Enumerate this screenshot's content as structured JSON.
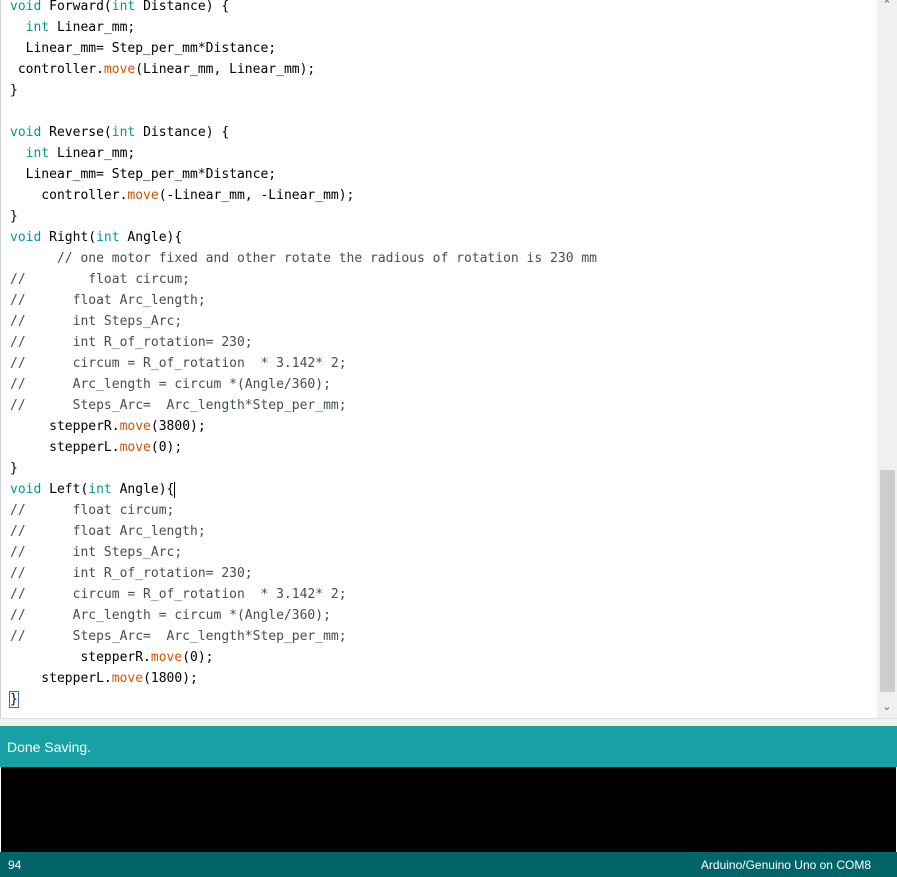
{
  "editor": {
    "lines": [
      [
        {
          "t": "void",
          "c": "kw"
        },
        {
          "t": " Forward(",
          "c": "p"
        },
        {
          "t": "int",
          "c": "kw"
        },
        {
          "t": " Distance) {",
          "c": "p"
        }
      ],
      [
        {
          "t": "  ",
          "c": "p"
        },
        {
          "t": "int",
          "c": "kw"
        },
        {
          "t": " Linear_mm;",
          "c": "p"
        }
      ],
      [
        {
          "t": "  Linear_mm= Step_per_mm*Distance;",
          "c": "p"
        }
      ],
      [
        {
          "t": " controller.",
          "c": "p"
        },
        {
          "t": "move",
          "c": "fn"
        },
        {
          "t": "(Linear_mm, Linear_mm);",
          "c": "p"
        }
      ],
      [
        {
          "t": "}",
          "c": "p"
        }
      ],
      [],
      [
        {
          "t": "void",
          "c": "kw"
        },
        {
          "t": " Reverse(",
          "c": "p"
        },
        {
          "t": "int",
          "c": "kw"
        },
        {
          "t": " Distance) {",
          "c": "p"
        }
      ],
      [
        {
          "t": "  ",
          "c": "p"
        },
        {
          "t": "int",
          "c": "kw"
        },
        {
          "t": " Linear_mm;",
          "c": "p"
        }
      ],
      [
        {
          "t": "  Linear_mm= Step_per_mm*Distance;",
          "c": "p"
        }
      ],
      [
        {
          "t": "    controller.",
          "c": "p"
        },
        {
          "t": "move",
          "c": "fn"
        },
        {
          "t": "(-Linear_mm, -Linear_mm);",
          "c": "p"
        }
      ],
      [
        {
          "t": "}",
          "c": "p"
        }
      ],
      [
        {
          "t": "void",
          "c": "kw"
        },
        {
          "t": " Right(",
          "c": "p"
        },
        {
          "t": "int",
          "c": "kw"
        },
        {
          "t": " Angle){",
          "c": "p"
        }
      ],
      [
        {
          "t": "      // one motor fixed and other rotate the radious of rotation is 230 mm",
          "c": "cm"
        }
      ],
      [
        {
          "t": "//        float circum;",
          "c": "cm"
        }
      ],
      [
        {
          "t": "//      float Arc_length;",
          "c": "cm"
        }
      ],
      [
        {
          "t": "//      int Steps_Arc;",
          "c": "cm"
        }
      ],
      [
        {
          "t": "//      int R_of_rotation= 230;",
          "c": "cm"
        }
      ],
      [
        {
          "t": "//      circum = R_of_rotation  * 3.142* 2;",
          "c": "cm"
        }
      ],
      [
        {
          "t": "//      Arc_length = circum *(Angle/360);",
          "c": "cm"
        }
      ],
      [
        {
          "t": "//      Steps_Arc=  Arc_length*Step_per_mm;",
          "c": "cm"
        }
      ],
      [
        {
          "t": "     stepperR.",
          "c": "p"
        },
        {
          "t": "move",
          "c": "fn"
        },
        {
          "t": "(3800);",
          "c": "p"
        }
      ],
      [
        {
          "t": "     stepperL.",
          "c": "p"
        },
        {
          "t": "move",
          "c": "fn"
        },
        {
          "t": "(0);",
          "c": "p"
        }
      ],
      [
        {
          "t": "}",
          "c": "p"
        }
      ],
      [
        {
          "t": "void",
          "c": "kw"
        },
        {
          "t": " Left(",
          "c": "p"
        },
        {
          "t": "int",
          "c": "kw"
        },
        {
          "t": " Angle){",
          "c": "p"
        },
        {
          "t": "",
          "c": "caret"
        }
      ],
      [
        {
          "t": "//      float circum;",
          "c": "cm"
        }
      ],
      [
        {
          "t": "//      float Arc_length;",
          "c": "cm"
        }
      ],
      [
        {
          "t": "//      int Steps_Arc;",
          "c": "cm"
        }
      ],
      [
        {
          "t": "//      int R_of_rotation= 230;",
          "c": "cm"
        }
      ],
      [
        {
          "t": "//      circum = R_of_rotation  * 3.142* 2;",
          "c": "cm"
        }
      ],
      [
        {
          "t": "//      Arc_length = circum *(Angle/360);",
          "c": "cm"
        }
      ],
      [
        {
          "t": "//      Steps_Arc=  Arc_length*Step_per_mm;",
          "c": "cm"
        }
      ],
      [
        {
          "t": "         stepperR.",
          "c": "p"
        },
        {
          "t": "move",
          "c": "fn"
        },
        {
          "t": "(0);",
          "c": "p"
        }
      ],
      [
        {
          "t": "    stepperL.",
          "c": "p"
        },
        {
          "t": "move",
          "c": "fn"
        },
        {
          "t": "(1800);",
          "c": "p"
        }
      ],
      [
        {
          "t": "}",
          "c": "bracket"
        }
      ]
    ]
  },
  "status": {
    "message": "Done Saving."
  },
  "footer": {
    "line_number": "94",
    "board_info": "Arduino/Genuino Uno on COM8"
  },
  "colors": {
    "keyword": "#00979c",
    "function": "#d35400",
    "comment": "#434f54",
    "status_bar": "#17a1a5",
    "footer": "#006468",
    "console": "#000000"
  },
  "icons": {
    "scroll_up": "chevron-up-icon",
    "scroll_down": "chevron-down-icon"
  }
}
